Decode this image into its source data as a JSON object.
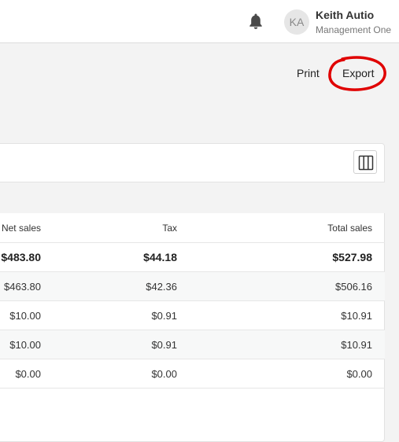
{
  "header": {
    "notifications_icon": "bell-icon",
    "user": {
      "initials": "KA",
      "name": "Keith Autio",
      "org": "Management One"
    }
  },
  "actions": {
    "print": "Print",
    "export": "Export"
  },
  "annotation": {
    "color": "#e00000",
    "shape": "circle around Export"
  },
  "table": {
    "columns_icon": "columns-icon",
    "headers": [
      "Net sales",
      "Tax",
      "Total sales"
    ],
    "rows": [
      [
        "$483.80",
        "$44.18",
        "$527.98"
      ],
      [
        "$463.80",
        "$42.36",
        "$506.16"
      ],
      [
        "$10.00",
        "$0.91",
        "$10.91"
      ],
      [
        "$10.00",
        "$0.91",
        "$10.91"
      ],
      [
        "$0.00",
        "$0.00",
        "$0.00"
      ]
    ]
  }
}
